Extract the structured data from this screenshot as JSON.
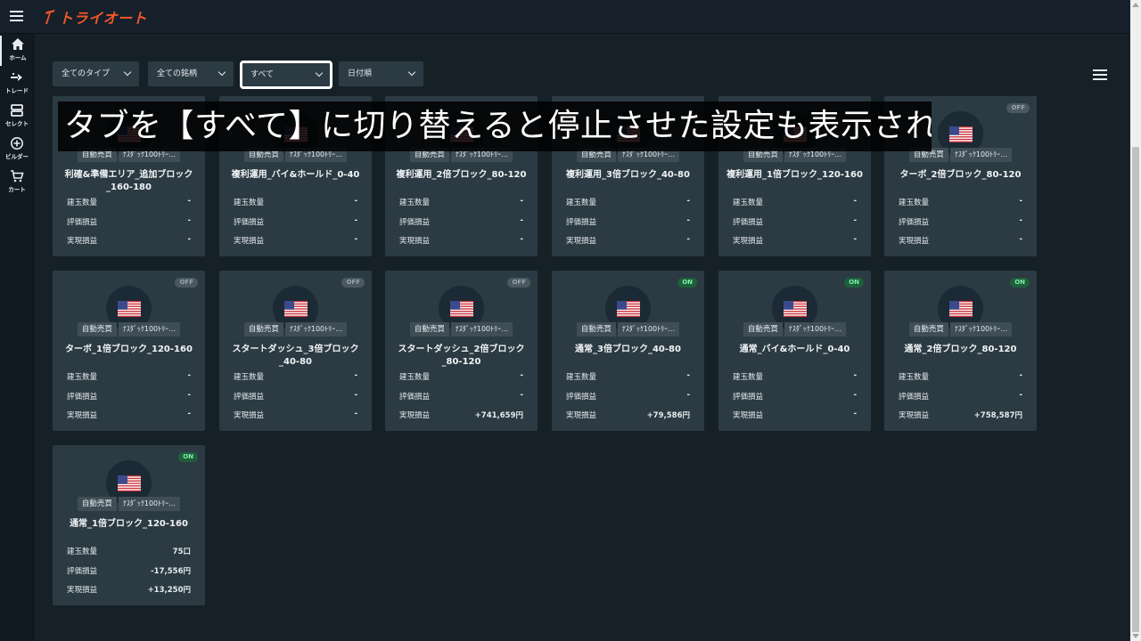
{
  "app": {
    "logo_text": "トライオート",
    "accent_color": "#f0572a"
  },
  "nav": {
    "items": [
      {
        "label": "ホーム",
        "icon": "home-icon"
      },
      {
        "label": "トレード",
        "icon": "trade-icon"
      },
      {
        "label": "セレクト",
        "icon": "select-icon"
      },
      {
        "label": "ビルダー",
        "icon": "builder-icon"
      },
      {
        "label": "カート",
        "icon": "cart-icon"
      }
    ]
  },
  "filters": {
    "type": "全てのタイプ",
    "symbol": "全ての銘柄",
    "tab": "すべて",
    "sort": "日付順"
  },
  "caption": "タブを【すべて】に切り替えると停止させた設定も表示される",
  "card_labels": {
    "positions": "建玉数量",
    "unrealized": "評価損益",
    "realized": "実現損益"
  },
  "cards": [
    {
      "title": "利確&準備エリア_追加ブロック_160-180",
      "status": "",
      "tag1": "自動売買",
      "tag2": "ﾅｽﾀﾞｯｸ100ﾄﾘｰ…",
      "positions": "-",
      "unrealized": "-",
      "realized": "-"
    },
    {
      "title": "複利運用_バイ&ホールド_0-40",
      "status": "",
      "tag1": "自動売買",
      "tag2": "ﾅｽﾀﾞｯｸ100ﾄﾘｰ…",
      "positions": "-",
      "unrealized": "-",
      "realized": "-"
    },
    {
      "title": "複利運用_2倍ブロック_80-120",
      "status": "",
      "tag1": "自動売買",
      "tag2": "ﾅｽﾀﾞｯｸ100ﾄﾘｰ…",
      "positions": "-",
      "unrealized": "-",
      "realized": "-"
    },
    {
      "title": "複利運用_3倍ブロック_40-80",
      "status": "",
      "tag1": "自動売買",
      "tag2": "ﾅｽﾀﾞｯｸ100ﾄﾘｰ…",
      "positions": "-",
      "unrealized": "-",
      "realized": "-"
    },
    {
      "title": "複利運用_1倍ブロック_120-160",
      "status": "",
      "tag1": "自動売買",
      "tag2": "ﾅｽﾀﾞｯｸ100ﾄﾘｰ…",
      "positions": "-",
      "unrealized": "-",
      "realized": "-"
    },
    {
      "title": "ターボ_2倍ブロック_80-120",
      "status": "OFF",
      "tag1": "自動売買",
      "tag2": "ﾅｽﾀﾞｯｸ100ﾄﾘｰ…",
      "positions": "-",
      "unrealized": "-",
      "realized": "-"
    },
    {
      "title": "ターボ_1倍ブロック_120-160",
      "status": "OFF",
      "tag1": "自動売買",
      "tag2": "ﾅｽﾀﾞｯｸ100ﾄﾘｰ…",
      "positions": "-",
      "unrealized": "-",
      "realized": "-"
    },
    {
      "title": "スタートダッシュ_3倍ブロック_40-80",
      "status": "OFF",
      "tag1": "自動売買",
      "tag2": "ﾅｽﾀﾞｯｸ100ﾄﾘｰ…",
      "positions": "-",
      "unrealized": "-",
      "realized": "-"
    },
    {
      "title": "スタートダッシュ_2倍ブロック_80-120",
      "status": "OFF",
      "tag1": "自動売買",
      "tag2": "ﾅｽﾀﾞｯｸ100ﾄﾘｰ…",
      "positions": "-",
      "unrealized": "-",
      "realized": "+741,659円"
    },
    {
      "title": "通常_3倍ブロック_40-80",
      "status": "ON",
      "tag1": "自動売買",
      "tag2": "ﾅｽﾀﾞｯｸ100ﾄﾘｰ…",
      "positions": "-",
      "unrealized": "-",
      "realized": "+79,586円"
    },
    {
      "title": "通常_バイ&ホールド_0-40",
      "status": "ON",
      "tag1": "自動売買",
      "tag2": "ﾅｽﾀﾞｯｸ100ﾄﾘｰ…",
      "positions": "-",
      "unrealized": "-",
      "realized": "-"
    },
    {
      "title": "通常_2倍ブロック_80-120",
      "status": "ON",
      "tag1": "自動売買",
      "tag2": "ﾅｽﾀﾞｯｸ100ﾄﾘｰ…",
      "positions": "-",
      "unrealized": "-",
      "realized": "+758,587円"
    },
    {
      "title": "通常_1倍ブロック_120-160",
      "status": "ON",
      "tag1": "自動売買",
      "tag2": "ﾅｽﾀﾞｯｸ100ﾄﾘｰ…",
      "positions": "75口",
      "unrealized": "-17,556円",
      "realized": "+13,250円"
    }
  ]
}
